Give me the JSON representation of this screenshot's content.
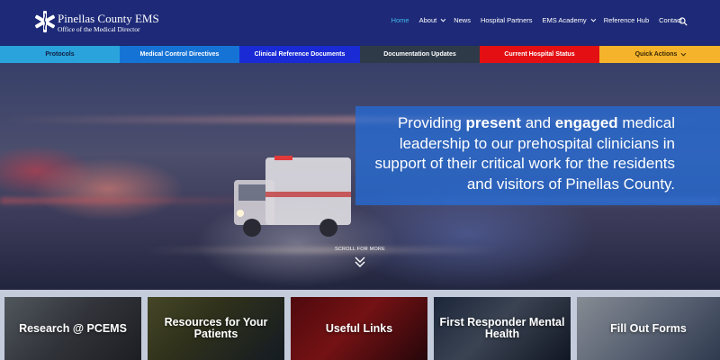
{
  "header": {
    "logo_title": "Pinellas County EMS",
    "logo_subtitle": "Office of the Medical Director",
    "nav": [
      {
        "label": "Home",
        "active": true,
        "has_dropdown": false
      },
      {
        "label": "About",
        "active": false,
        "has_dropdown": true
      },
      {
        "label": "News",
        "active": false,
        "has_dropdown": false
      },
      {
        "label": "Hospital Partners",
        "active": false,
        "has_dropdown": false
      },
      {
        "label": "EMS Academy",
        "active": false,
        "has_dropdown": true
      },
      {
        "label": "Reference Hub",
        "active": false,
        "has_dropdown": false
      },
      {
        "label": "Contact",
        "active": false,
        "has_dropdown": false
      }
    ],
    "search_icon": "search-icon"
  },
  "subnav": [
    {
      "label": "Protocols",
      "color": "#2aa3dd"
    },
    {
      "label": "Medical Control Directives",
      "color": "#1673d6"
    },
    {
      "label": "Clinical Reference Documents",
      "color": "#1a2bd6"
    },
    {
      "label": "Documentation Updates",
      "color": "#2e3a48"
    },
    {
      "label": "Current Hospital Status",
      "color": "#e40f13"
    },
    {
      "label": "Quick Actions",
      "color": "#f4b32a"
    }
  ],
  "hero": {
    "text_1": "Providing ",
    "text_bold_1": "present",
    "text_2": " and ",
    "text_bold_2": "engaged",
    "text_3": " medical leadership to our prehospital clinicians in support of their critical work for the residents and visitors of Pinellas County.",
    "scroll_label": "SCROLL FOR MORE"
  },
  "cards": [
    {
      "title": "Research @ PCEMS"
    },
    {
      "title": "Resources for Your Patients"
    },
    {
      "title": "Useful Links"
    },
    {
      "title": "First Responder Mental Health"
    },
    {
      "title": "Fill Out Forms"
    }
  ],
  "colors": {
    "header_bg": "#1e2a78",
    "nav_active": "#3fb6ea",
    "hero_band": "#236edc"
  }
}
